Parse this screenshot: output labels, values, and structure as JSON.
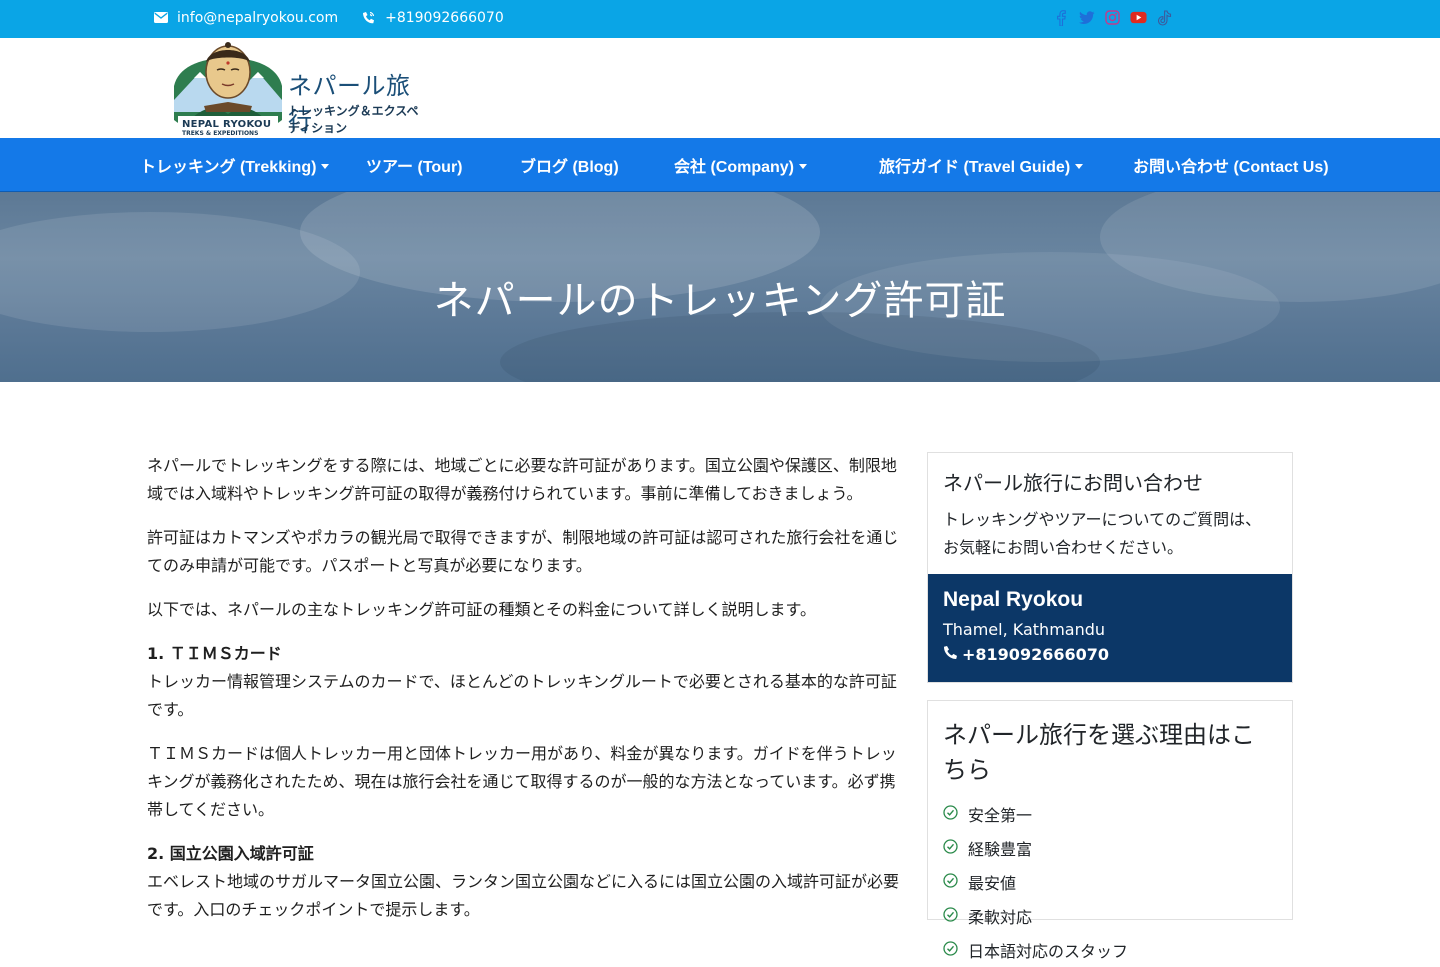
{
  "topbar": {
    "email": "info@nepalryokou.com",
    "phone": "+819092666070",
    "icons": [
      "envelope-icon",
      "phone-volume-icon"
    ],
    "social": [
      {
        "name": "facebook-icon",
        "color": "#0aa5e6"
      },
      {
        "name": "twitter-icon",
        "color": "#0aa5e6"
      },
      {
        "name": "instagram-icon",
        "color": "#0aa5e6"
      },
      {
        "name": "youtube-icon",
        "color": "#e02a20"
      },
      {
        "name": "tiktok-icon",
        "color": "#0aa5e6"
      }
    ]
  },
  "logo": {
    "jp_main": "ネパール旅行",
    "jp_sub": "トレッキング＆エクスペディション",
    "en_main": "NEPAL RYOKOU",
    "en_sub": "TREKS & EXPEDITIONS"
  },
  "nav": {
    "items": [
      {
        "label": "トレッキング (Trekking)",
        "dropdown": true
      },
      {
        "label": "ツアー (Tour)",
        "dropdown": false
      },
      {
        "label": "ブログ (Blog)",
        "dropdown": false
      },
      {
        "label": "会社 (Company)",
        "dropdown": true
      },
      {
        "label": "旅行ガイド (Travel Guide)",
        "dropdown": true
      },
      {
        "label": "お問い合わせ (Contact Us)",
        "dropdown": false
      }
    ]
  },
  "hero": {
    "title": "ネパールのトレッキング許可証"
  },
  "content": {
    "paragraphs": [
      {
        "heading": "",
        "text": "ネパールでトレッキングをする際には、地域ごとに必要な許可証があります。国立公園や保護区、制限地域では入域料やトレッキング許可証の取得が義務付けられています。事前に準備しておきましょう。"
      },
      {
        "heading": "",
        "text": "許可証はカトマンズやポカラの観光局で取得できますが、制限地域の許可証は認可された旅行会社を通じてのみ申請が可能です。パスポートと写真が必要になります。"
      },
      {
        "heading": "",
        "text": "以下では、ネパールの主なトレッキング許可証の種類とその料金について詳しく説明します。"
      },
      {
        "heading": "1. ＴＩＭＳカード",
        "text": "トレッカー情報管理システムのカードで、ほとんどのトレッキングルートで必要とされる基本的な許可証です。"
      },
      {
        "heading": "",
        "text": "ＴＩＭＳカードは個人トレッカー用と団体トレッカー用があり、料金が異なります。ガイドを伴うトレッキングが義務化されたため、現在は旅行会社を通じて取得するのが一般的な方法となっています。必ず携帯してください。"
      },
      {
        "heading": "2. 国立公園入域許可証",
        "text": "エベレスト地域のサガルマータ国立公園、ランタン国立公園などに入るには国立公園の入域許可証が必要です。入口のチェックポイントで提示します。"
      }
    ]
  },
  "sidebar": {
    "card_title": "ネパール旅行にお問い合わせ",
    "card_desc": "トレッキングやツアーについてのご質問は、お気軽にお問い合わせください。",
    "company_name": "Nepal Ryokou",
    "location": "Thamel, Kathmandu",
    "phone": "+819092666070",
    "why_title": "ネパール旅行を選ぶ理由はこちら",
    "why_items": [
      "安全第一",
      "経験豊富",
      "最安値",
      "柔軟対応",
      "日本語対応のスタッフ"
    ]
  },
  "colors": {
    "topbar": "#0aa5e6",
    "nav": "#1479e8",
    "sidebar_dark": "#0c3767",
    "check": "#2a8a4a"
  }
}
